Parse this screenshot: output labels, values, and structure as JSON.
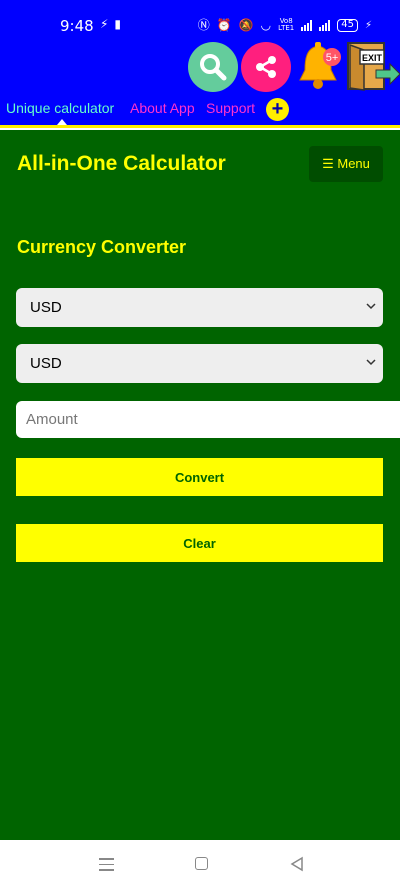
{
  "status_bar": {
    "time": "9:48",
    "network_label_top": "Vo8",
    "network_label_bottom": "LTE1",
    "battery": "45"
  },
  "toolbar": {
    "icons": [
      "search-icon",
      "share-icon",
      "bell-icon",
      "exit-icon"
    ],
    "bell_badge": "5+",
    "exit_label": "EXIT"
  },
  "tabs": [
    {
      "label": "Unique calculator",
      "color": "#66ffcc"
    },
    {
      "label": "About App",
      "color": "#ff33cc"
    },
    {
      "label": "Support",
      "color": "#ff33cc"
    }
  ],
  "tab_add_label": "+",
  "app": {
    "title": "All-in-One Calculator",
    "menu_label": "☰ Menu",
    "section_title": "Currency Converter",
    "from_currency": "USD",
    "to_currency": "USD",
    "amount_placeholder": "Amount",
    "convert_label": "Convert",
    "clear_label": "Clear",
    "colors": {
      "background": "#006400",
      "accent": "#ffff00",
      "toolbar": "#0000ff"
    }
  },
  "nav_bar": {
    "icons": [
      "recents-icon",
      "home-icon",
      "back-icon"
    ]
  }
}
